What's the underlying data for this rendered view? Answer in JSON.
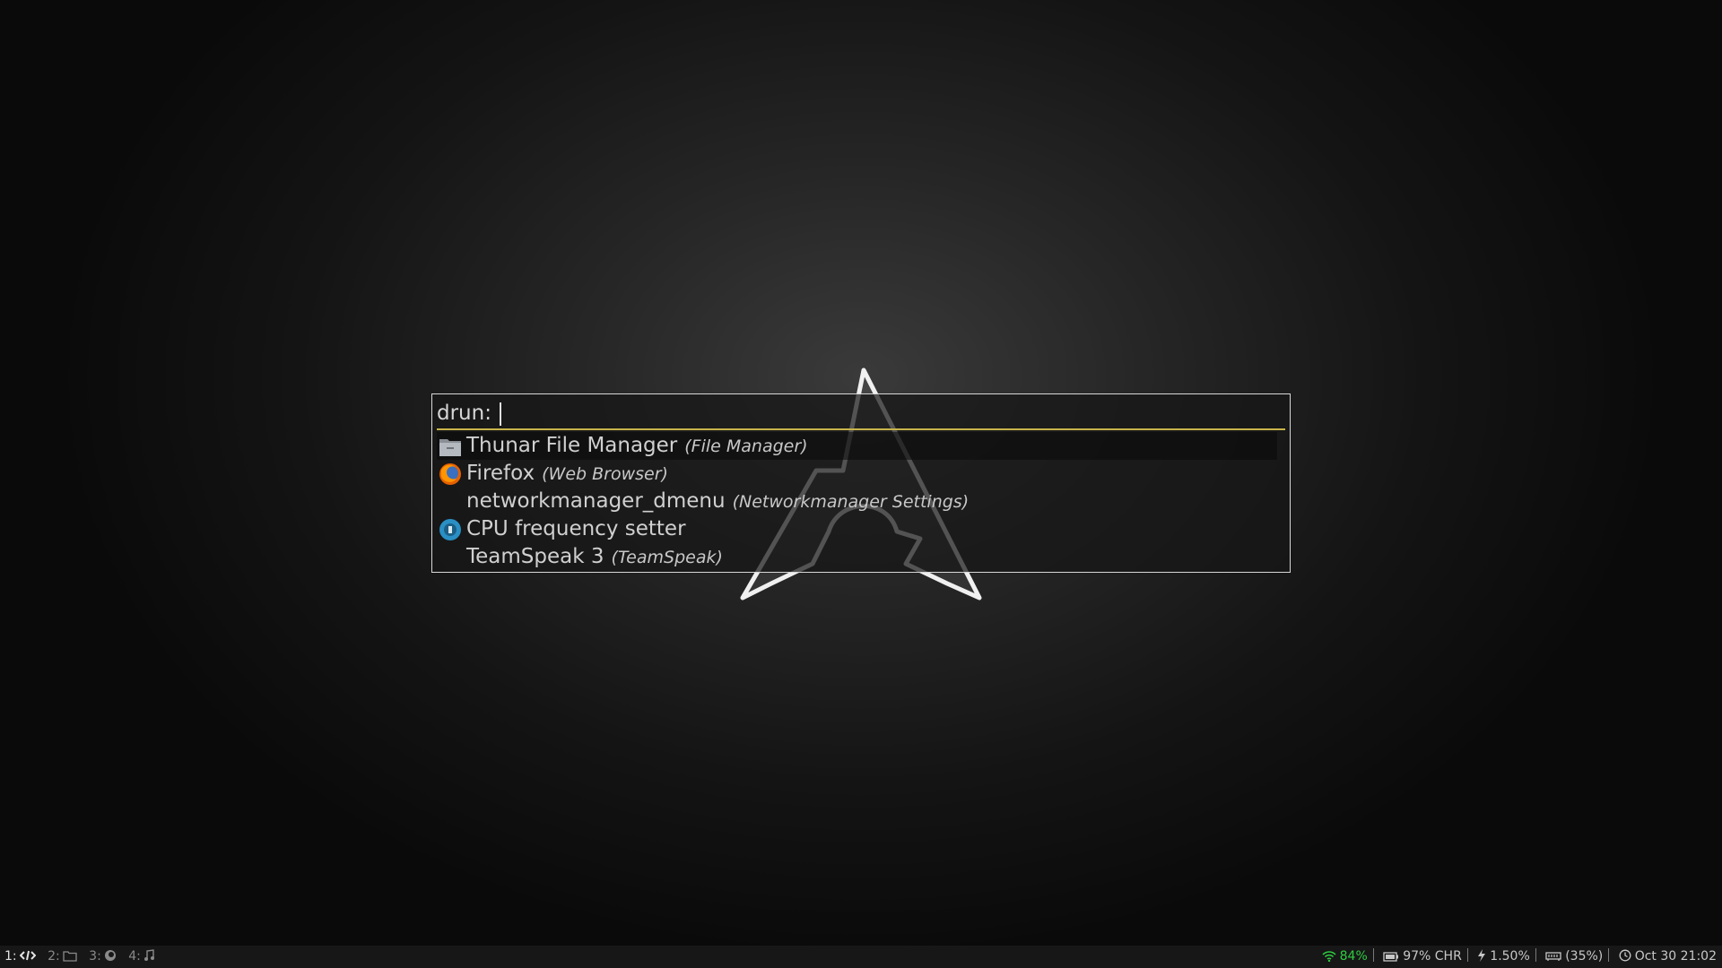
{
  "launcher": {
    "prompt": "drun:",
    "input_value": "",
    "accent_color": "#c8b44a",
    "entries": [
      {
        "name": "Thunar File Manager",
        "generic": "(File Manager)",
        "icon": "folder-icon",
        "selected": true
      },
      {
        "name": "Firefox",
        "generic": "(Web Browser)",
        "icon": "firefox-icon",
        "selected": false
      },
      {
        "name": "networkmanager_dmenu",
        "generic": "(Networkmanager Settings)",
        "icon": "",
        "selected": false
      },
      {
        "name": "CPU frequency setter",
        "generic": "",
        "icon": "cpu-frequency-icon",
        "selected": false
      },
      {
        "name": "TeamSpeak 3",
        "generic": "(TeamSpeak)",
        "icon": "",
        "selected": false
      }
    ]
  },
  "statusbar": {
    "workspaces": [
      {
        "label": "1:",
        "icon": "code-icon",
        "focused": true
      },
      {
        "label": "2:",
        "icon": "folder-icon",
        "focused": false
      },
      {
        "label": "3:",
        "icon": "firefox-icon",
        "focused": false
      },
      {
        "label": "4:",
        "icon": "music-icon",
        "focused": false
      }
    ],
    "wifi": "84%",
    "wifi_color": "#2ecc40",
    "battery": "97% CHR",
    "cpu": "1.50%",
    "memory": "(35%)",
    "datetime": "Oct 30 21:02"
  }
}
